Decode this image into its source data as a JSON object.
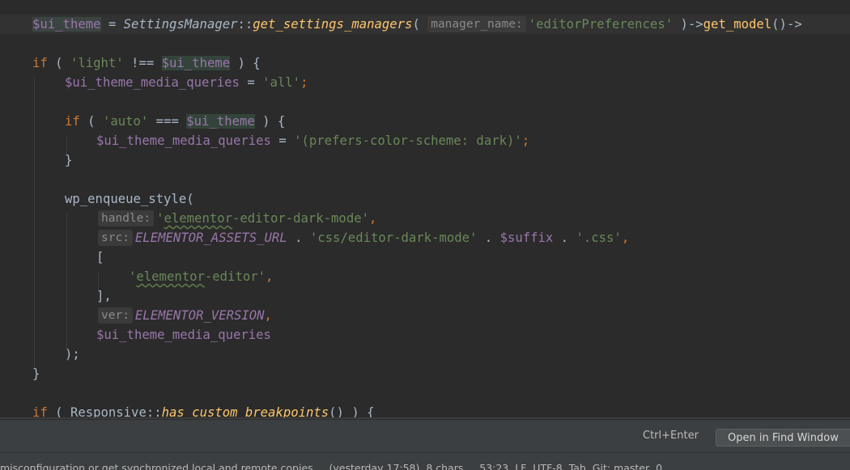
{
  "code": {
    "l1": {
      "var": "$ui_theme",
      "op1": " = ",
      "cls": "SettingsManager",
      "sep": "::",
      "fn": "get_settings_managers",
      "paren": "( ",
      "hint": "manager_name:",
      "str": "'editorPreferences'",
      "rest1": " )->",
      "fn2": "get_model",
      "rest2": "()->"
    },
    "l2": {
      "kw": "if",
      "p1": " ( ",
      "str": "'light'",
      "op": " !== ",
      "var": "$ui_theme",
      "p2": " ) {"
    },
    "l3": {
      "var": "$ui_theme_media_queries",
      "op": " = ",
      "str": "'all'",
      "end": ";"
    },
    "l4": {
      "kw": "if",
      "p1": " ( ",
      "str": "'auto'",
      "op": " === ",
      "var": "$ui_theme",
      "p2": " ) {"
    },
    "l5": {
      "var": "$ui_theme_media_queries",
      "op": " = ",
      "str": "'(prefers-color-scheme: dark)'",
      "end": ";"
    },
    "l6": {
      "text": "}"
    },
    "l7": {
      "fn": "wp_enqueue_style",
      "p": "("
    },
    "l8": {
      "hint": "handle:",
      "q1": "'",
      "s1": "elementor",
      "s2": "-editor-dark-mode'",
      "end": ","
    },
    "l9": {
      "hint": "src:",
      "const": "ELEMENTOR_ASSETS_URL",
      "op1": " . ",
      "str1": "'css/editor-dark-mode'",
      "op2": " . ",
      "var": "$suffix",
      "op3": " . ",
      "str2": "'.css'",
      "end": ","
    },
    "l10": {
      "text": "["
    },
    "l11": {
      "q1": "'",
      "s1": "elementor",
      "s2": "-editor'",
      "end": ","
    },
    "l12": {
      "text": "],"
    },
    "l13": {
      "hint": "ver:",
      "const": "ELEMENTOR_VERSION",
      "end": ","
    },
    "l14": {
      "var": "$ui_theme_media_queries"
    },
    "l15": {
      "text": ");"
    },
    "l16": {
      "text": "}"
    },
    "l17": {
      "kw": "if",
      "p1": " ( ",
      "cls": "Responsive",
      "sep": "::",
      "fn": "has_custom_breakpoints",
      "p2": "() ) {"
    }
  },
  "findbar": {
    "shortcut": "Ctrl+Enter",
    "open_button": "Open in Find Window"
  },
  "statusbar": {
    "text": "misconfiguration or get synchronized local and remote copies     (yesterday 17:58)  8 chars     53:23  LF  UTF-8  Tab  Git: master  0"
  },
  "colors": {
    "editor_bg": "#2b2b2b",
    "keyword": "#cc7832",
    "string": "#6a8759",
    "variable": "#9876aa",
    "function": "#ffc66d",
    "text": "#a9b7c6"
  }
}
